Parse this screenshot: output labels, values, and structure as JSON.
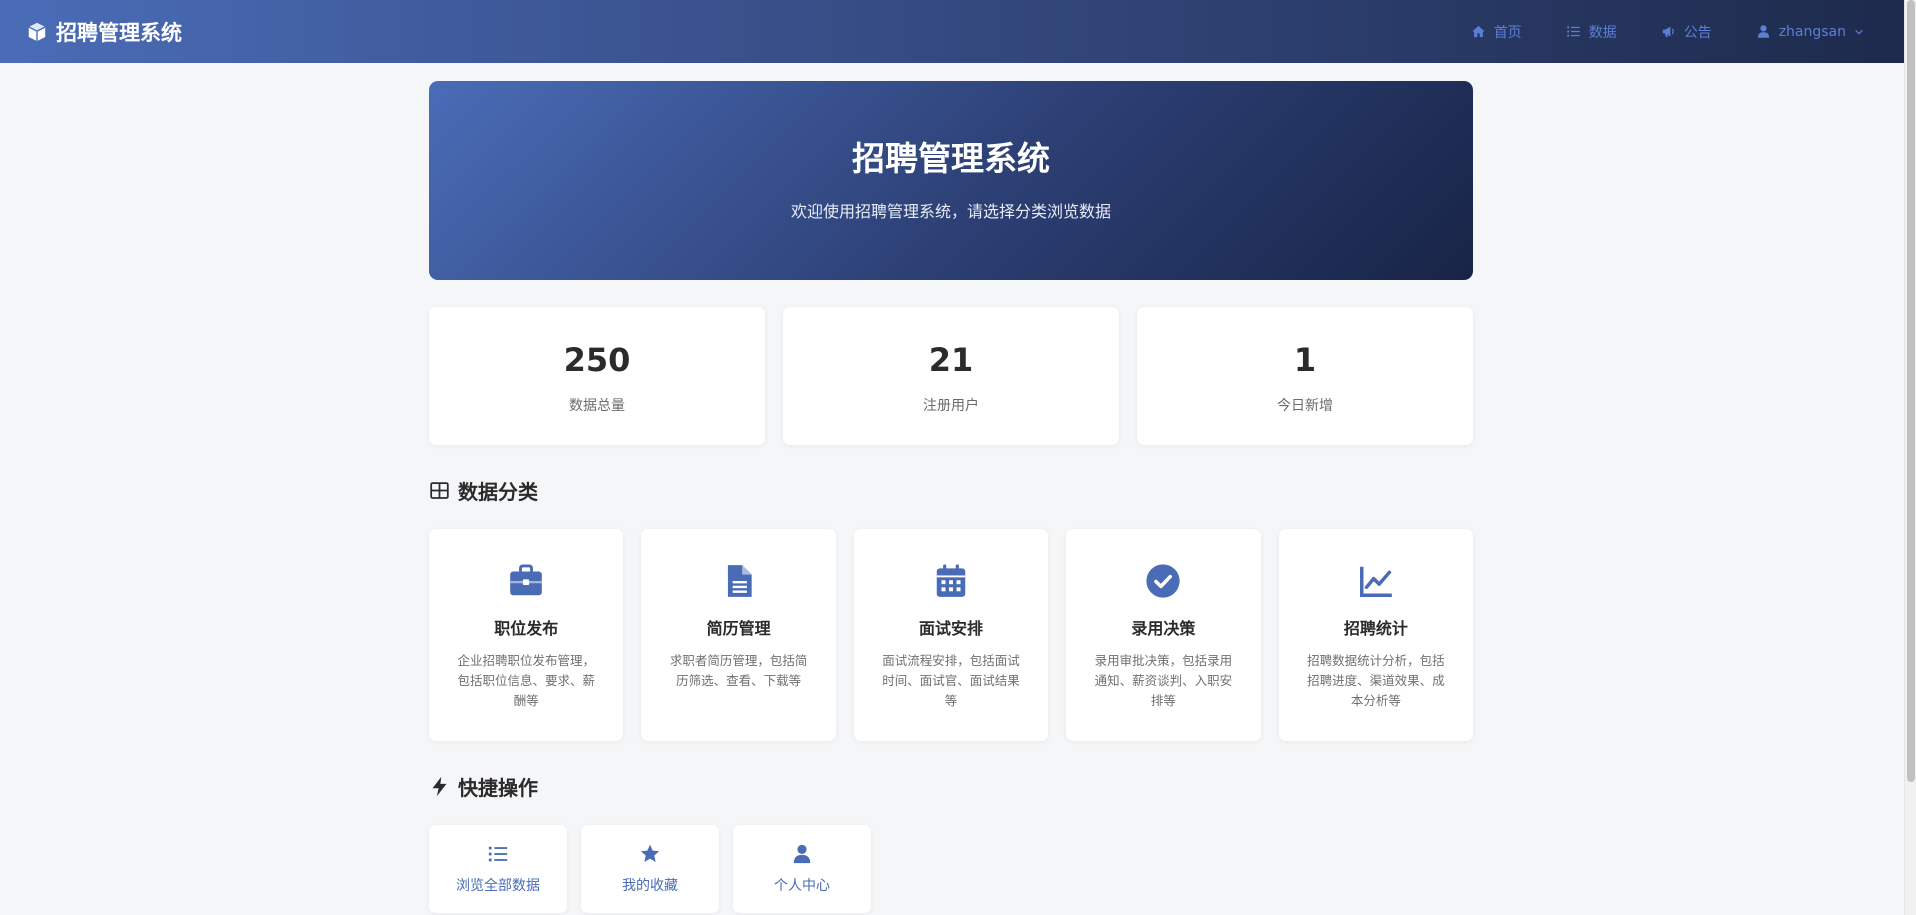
{
  "navbar": {
    "brand": "招聘管理系统",
    "items": [
      {
        "label": "首页",
        "icon": "home-icon"
      },
      {
        "label": "数据",
        "icon": "list-icon"
      },
      {
        "label": "公告",
        "icon": "megaphone-icon"
      }
    ],
    "user": {
      "name": "zhangsan",
      "icon": "user-icon"
    }
  },
  "hero": {
    "title": "招聘管理系统",
    "subtitle": "欢迎使用招聘管理系统，请选择分类浏览数据"
  },
  "stats": [
    {
      "value": "250",
      "label": "数据总量"
    },
    {
      "value": "21",
      "label": "注册用户"
    },
    {
      "value": "1",
      "label": "今日新增"
    }
  ],
  "categories_section": {
    "title": "数据分类",
    "items": [
      {
        "title": "职位发布",
        "desc": "企业招聘职位发布管理，包括职位信息、要求、薪酬等",
        "icon": "briefcase-icon"
      },
      {
        "title": "简历管理",
        "desc": "求职者简历管理，包括简历筛选、查看、下载等",
        "icon": "document-icon"
      },
      {
        "title": "面试安排",
        "desc": "面试流程安排，包括面试时间、面试官、面试结果等",
        "icon": "calendar-icon"
      },
      {
        "title": "录用决策",
        "desc": "录用审批决策，包括录用通知、薪资谈判、入职安排等",
        "icon": "check-circle-icon"
      },
      {
        "title": "招聘统计",
        "desc": "招聘数据统计分析，包括招聘进度、渠道效果、成本分析等",
        "icon": "line-chart-icon"
      }
    ]
  },
  "quick_section": {
    "title": "快捷操作",
    "items": [
      {
        "label": "浏览全部数据",
        "icon": "list-icon"
      },
      {
        "label": "我的收藏",
        "icon": "star-icon"
      },
      {
        "label": "个人中心",
        "icon": "user-icon"
      }
    ]
  },
  "colors": {
    "accent": "#4a6cb7",
    "nav_dark": "#1d2a4c",
    "nav_link": "#5b7fd6",
    "background": "#f5f6f8"
  }
}
